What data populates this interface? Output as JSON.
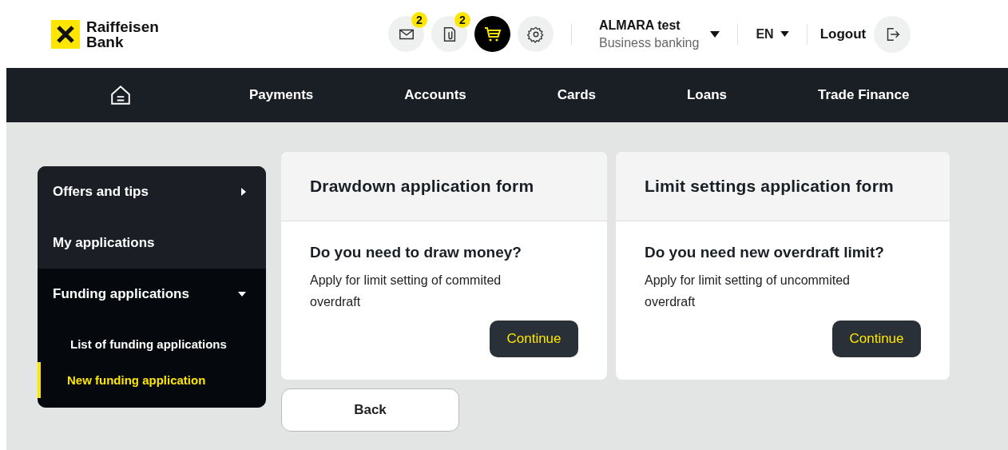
{
  "header": {
    "logo": {
      "line1": "Raiffeisen",
      "line2": "Bank"
    },
    "icons": [
      {
        "kind": "mail",
        "badge": "2",
        "active": false
      },
      {
        "kind": "document",
        "badge": "2",
        "active": false
      },
      {
        "kind": "cart",
        "active": true
      },
      {
        "kind": "settings",
        "active": false
      }
    ],
    "account": {
      "name": "ALMARA test",
      "subtitle": "Business banking"
    },
    "language": "EN",
    "logout": "Logout"
  },
  "nav": {
    "items": [
      "Payments",
      "Accounts",
      "Cards",
      "Loans",
      "Trade Finance"
    ]
  },
  "sidebar": {
    "items": [
      {
        "label": "Offers and tips",
        "expanded": false
      },
      {
        "label": "My applications"
      },
      {
        "label": "Funding applications",
        "expanded": true,
        "children": [
          {
            "label": "List of funding applications",
            "selected": false
          },
          {
            "label": "New funding application",
            "selected": true
          }
        ]
      }
    ]
  },
  "cards": [
    {
      "title": "Drawdown application form",
      "question": "Do you need to draw money?",
      "text": "Apply for limit setting of commited overdraft",
      "button": "Continue"
    },
    {
      "title": "Limit settings application form",
      "question": "Do you need new overdraft limit?",
      "text": "Apply for limit setting of uncommited overdraft",
      "button": "Continue"
    }
  ],
  "back_button": "Back"
}
